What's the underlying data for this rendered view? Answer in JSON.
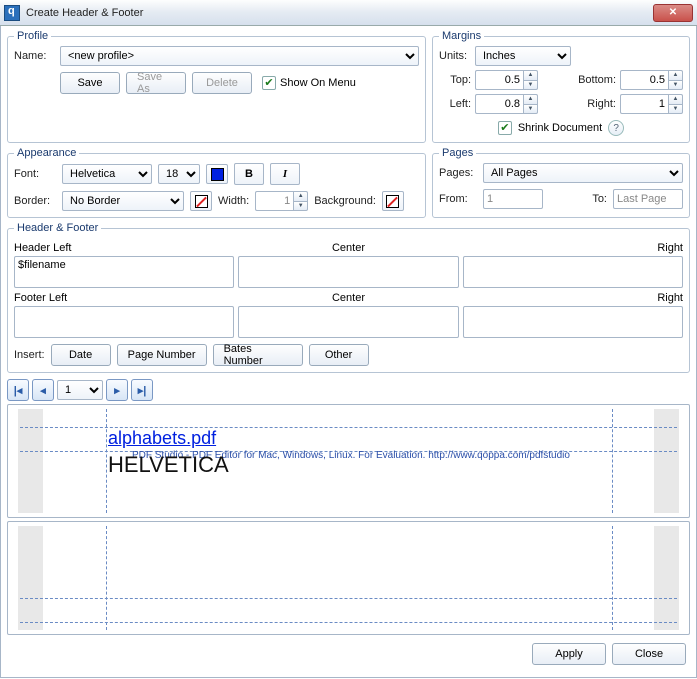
{
  "window": {
    "title": "Create Header & Footer"
  },
  "profile": {
    "legend": "Profile",
    "nameLabel": "Name:",
    "nameValue": "<new profile>",
    "save": "Save",
    "saveAs": "Save As",
    "delete": "Delete",
    "showOnMenu": "Show On Menu"
  },
  "margins": {
    "legend": "Margins",
    "unitsLabel": "Units:",
    "unitsValue": "Inches",
    "topLabel": "Top:",
    "topValue": "0.5",
    "bottomLabel": "Bottom:",
    "bottomValue": "0.5",
    "leftLabel": "Left:",
    "leftValue": "0.8",
    "rightLabel": "Right:",
    "rightValue": "1",
    "shrink": "Shrink Document"
  },
  "appearance": {
    "legend": "Appearance",
    "fontLabel": "Font:",
    "fontValue": "Helvetica",
    "sizeValue": "18",
    "fontColor": "#0020e0",
    "bold": "B",
    "italic": "I",
    "borderLabel": "Border:",
    "borderValue": "No Border",
    "widthLabel": "Width:",
    "widthValue": "1",
    "backgroundLabel": "Background:"
  },
  "pages": {
    "legend": "Pages",
    "pagesLabel": "Pages:",
    "pagesValue": "All Pages",
    "fromLabel": "From:",
    "fromValue": "1",
    "toLabel": "To:",
    "toValue": "Last Page"
  },
  "hf": {
    "legend": "Header & Footer",
    "headerLeftLabel": "Header Left",
    "centerLabel": "Center",
    "rightLabel": "Right",
    "footerLeftLabel": "Footer Left",
    "headerLeft": "$filename",
    "headerCenter": "",
    "headerRight": "",
    "footerLeft": "",
    "footerCenter": "",
    "footerRight": "",
    "insertLabel": "Insert:",
    "date": "Date",
    "pageNumber": "Page Number",
    "bates": "Bates Number",
    "other": "Other"
  },
  "nav": {
    "pageValue": "1"
  },
  "preview": {
    "filename": "alphabets.pdf",
    "eval": "PDF Studio - PDF Editor for Mac, Windows, Linux. For Evaluation. http://www.qoppa.com/pdfstudio",
    "sample": "HELVETICA"
  },
  "buttons": {
    "apply": "Apply",
    "close": "Close"
  }
}
